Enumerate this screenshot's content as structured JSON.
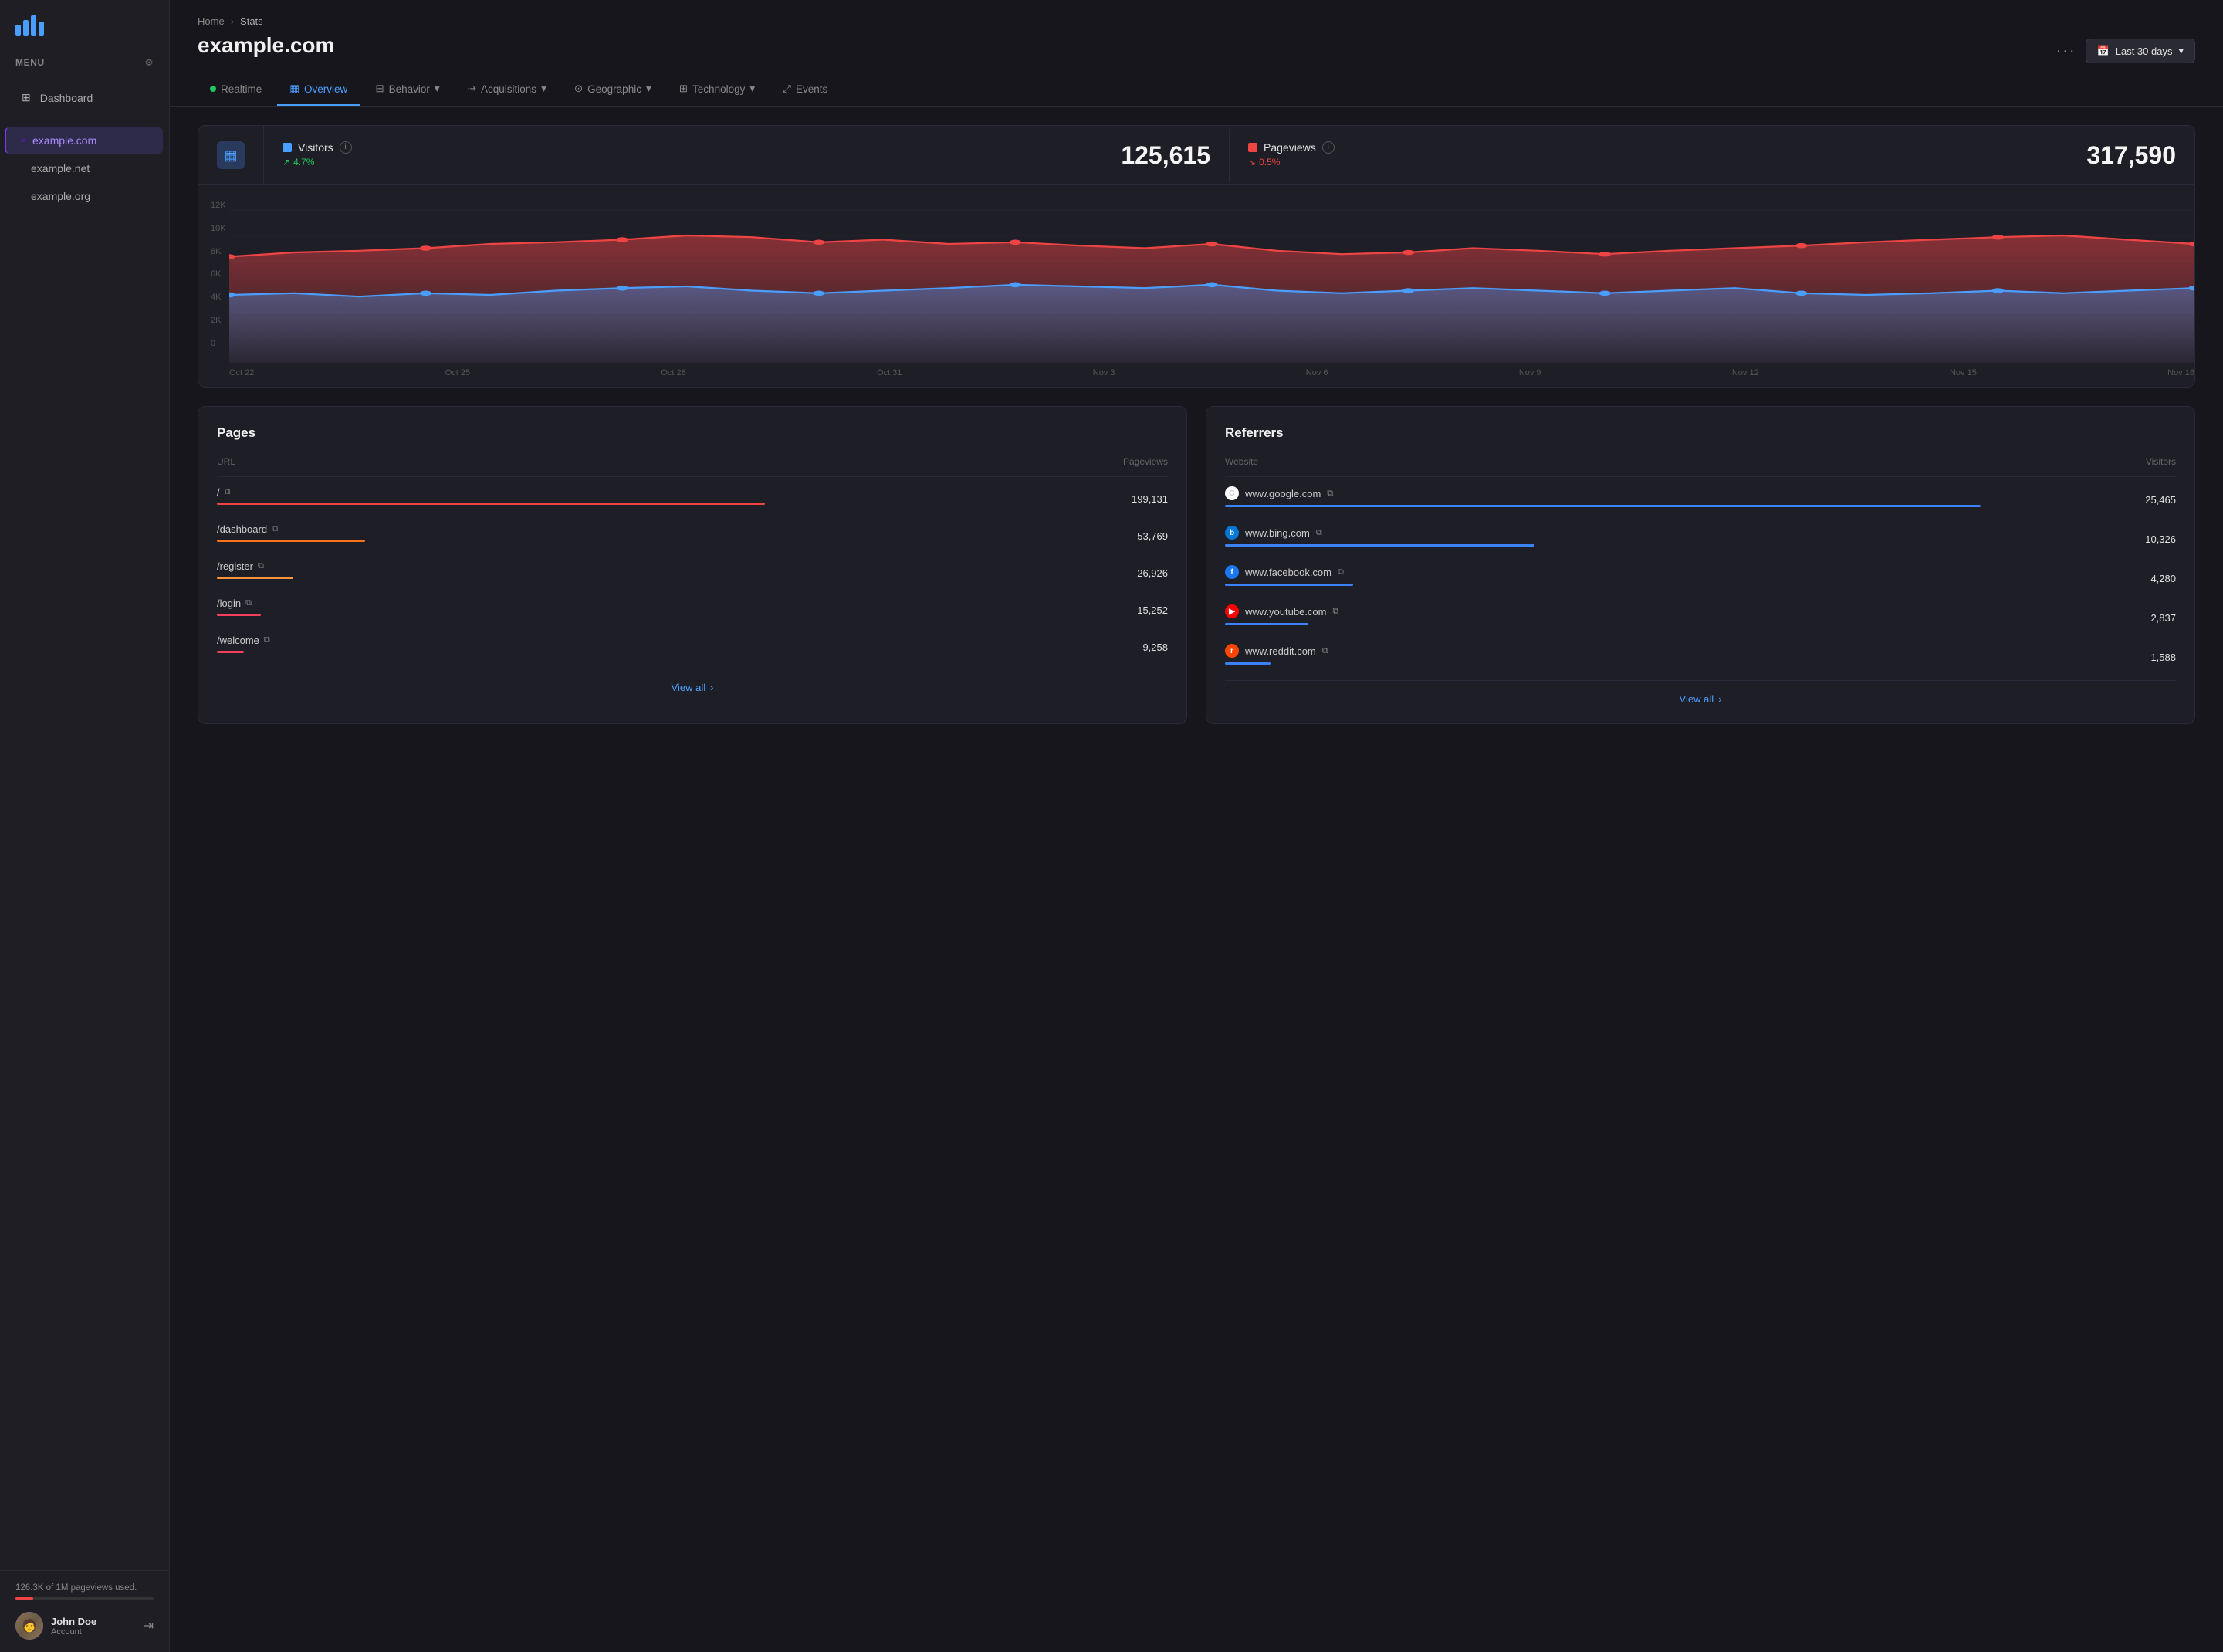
{
  "sidebar": {
    "menu_label": "MENU",
    "nav_items": [
      {
        "id": "dashboard",
        "label": "Dashboard",
        "icon": "grid"
      }
    ],
    "sites": [
      {
        "id": "example-com",
        "label": "example.com",
        "color": "purple",
        "active": true
      },
      {
        "id": "example-net",
        "label": "example.net",
        "color": "green",
        "active": false
      },
      {
        "id": "example-org",
        "label": "example.org",
        "color": "red",
        "active": false
      }
    ],
    "usage": {
      "text": "126.3K of 1M pageviews used.",
      "percent": 12.63
    },
    "user": {
      "name": "John Doe",
      "role": "Account"
    }
  },
  "header": {
    "breadcrumb_home": "Home",
    "breadcrumb_current": "Stats",
    "title": "example.com",
    "more_label": "···",
    "date_icon": "📅",
    "date_label": "Last 30 days"
  },
  "tabs": [
    {
      "id": "realtime",
      "label": "Realtime",
      "has_dot": true
    },
    {
      "id": "overview",
      "label": "Overview",
      "active": true
    },
    {
      "id": "behavior",
      "label": "Behavior",
      "has_chevron": true
    },
    {
      "id": "acquisitions",
      "label": "Acquisitions",
      "has_chevron": true
    },
    {
      "id": "geographic",
      "label": "Geographic",
      "has_chevron": true
    },
    {
      "id": "technology",
      "label": "Technology",
      "has_chevron": true
    },
    {
      "id": "events",
      "label": "Events"
    }
  ],
  "chart": {
    "visitors_label": "Visitors",
    "visitors_change": "4.7%",
    "visitors_change_dir": "up",
    "visitors_value": "125,615",
    "pageviews_label": "Pageviews",
    "pageviews_change": "0.5%",
    "pageviews_change_dir": "down",
    "pageviews_value": "317,590",
    "y_labels": [
      "12K",
      "10K",
      "8K",
      "6K",
      "4K",
      "2K",
      "0"
    ],
    "x_labels": [
      "Oct 22",
      "Oct 25",
      "Oct 28",
      "Oct 31",
      "Nov 3",
      "Nov 6",
      "Nov 9",
      "Nov 12",
      "Nov 15",
      "Nov 18"
    ]
  },
  "pages": {
    "title": "Pages",
    "col_url": "URL",
    "col_pageviews": "Pageviews",
    "rows": [
      {
        "url": "/",
        "pageviews": "199,131",
        "bar_width": "100%",
        "bar_class": "bar-red"
      },
      {
        "url": "/dashboard",
        "pageviews": "53,769",
        "bar_width": "27%",
        "bar_class": "bar-orange"
      },
      {
        "url": "/register",
        "pageviews": "26,926",
        "bar_width": "14%",
        "bar_class": "bar-orange2"
      },
      {
        "url": "/login",
        "pageviews": "15,252",
        "bar_width": "8%",
        "bar_class": "bar-rose"
      },
      {
        "url": "/welcome",
        "pageviews": "9,258",
        "bar_width": "5%",
        "bar_class": "bar-rose"
      }
    ],
    "view_all": "View all"
  },
  "referrers": {
    "title": "Referrers",
    "col_website": "Website",
    "col_visitors": "Visitors",
    "rows": [
      {
        "site": "www.google.com",
        "icon_class": "icon-google",
        "icon_label": "G",
        "visitors": "25,465",
        "bar_width": "100%",
        "bar_class": "bar-blue"
      },
      {
        "site": "www.bing.com",
        "icon_class": "icon-bing",
        "icon_label": "b",
        "visitors": "10,326",
        "bar_width": "41%",
        "bar_class": "bar-blue"
      },
      {
        "site": "www.facebook.com",
        "icon_class": "icon-facebook",
        "icon_label": "f",
        "visitors": "4,280",
        "bar_width": "17%",
        "bar_class": "bar-blue"
      },
      {
        "site": "www.youtube.com",
        "icon_class": "icon-youtube",
        "icon_label": "▶",
        "visitors": "2,837",
        "bar_width": "11%",
        "bar_class": "bar-blue"
      },
      {
        "site": "www.reddit.com",
        "icon_class": "icon-reddit",
        "icon_label": "r",
        "visitors": "1,588",
        "bar_width": "6%",
        "bar_class": "bar-blue"
      }
    ],
    "view_all": "View all"
  }
}
